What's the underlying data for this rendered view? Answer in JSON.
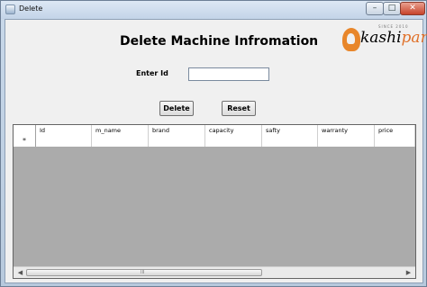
{
  "window": {
    "title": "Delete",
    "minimize_label": "–",
    "maximize_label": "□",
    "close_label": "✕"
  },
  "form": {
    "heading": "Delete Machine Infromation",
    "enter_id_label": "Enter Id",
    "id_value": "",
    "delete_button": "Delete",
    "reset_button": "Reset"
  },
  "logo": {
    "text_main": "kashi",
    "text_accent": "para",
    "small_text": "SINCE 2010"
  },
  "grid": {
    "columns": [
      "Id",
      "m_name",
      "brand",
      "capacity",
      "safty",
      "warranty",
      "price"
    ],
    "new_row_marker": "*",
    "scroll_grip": "III"
  }
}
